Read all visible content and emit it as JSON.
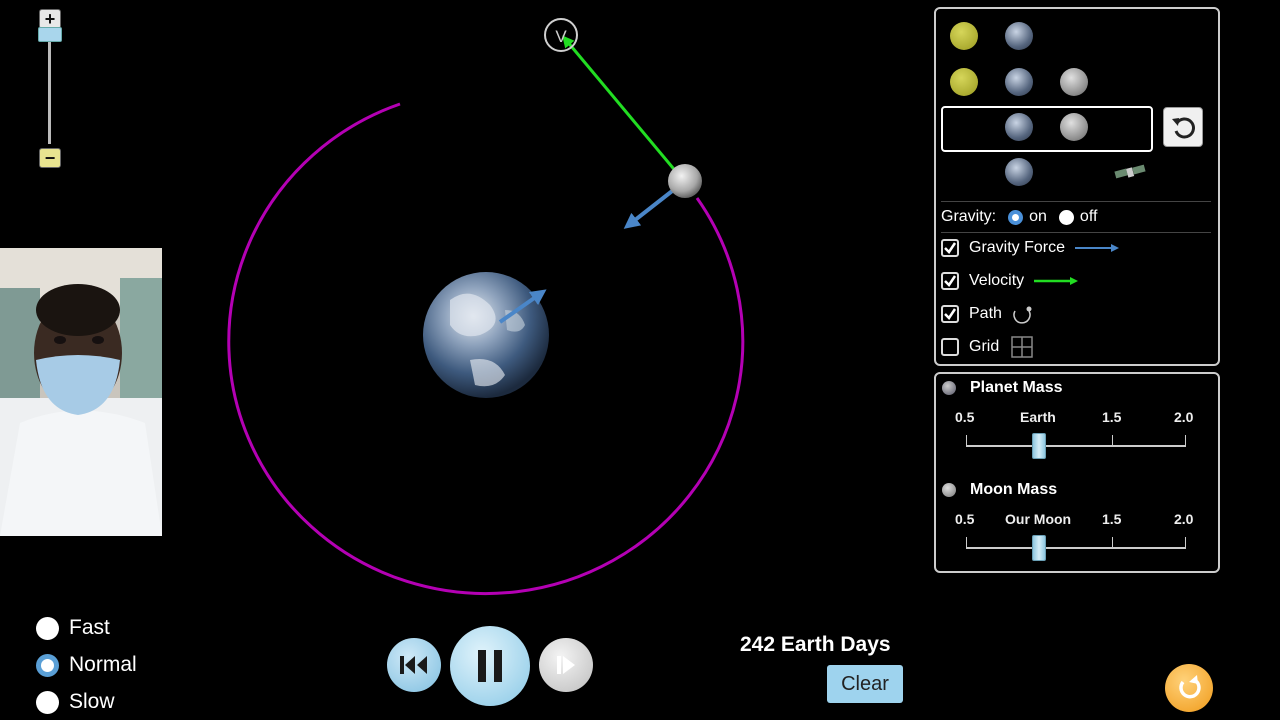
{
  "zoom": {
    "in_label": "+",
    "out_label": "−",
    "level": 0.94
  },
  "controls": {
    "gravity_label": "Gravity:",
    "gravity_on": "on",
    "gravity_off": "off",
    "gravity_selected": "on",
    "gravity_force_label": "Gravity Force",
    "velocity_label": "Velocity",
    "path_label": "Path",
    "grid_label": "Grid",
    "gravity_force_checked": true,
    "velocity_checked": true,
    "path_checked": true,
    "grid_checked": false
  },
  "planet_mass": {
    "title": "Planet Mass",
    "ticks": [
      "0.5",
      "Earth",
      "1.5",
      "2.0"
    ],
    "value": 1.0
  },
  "moon_mass": {
    "title": "Moon Mass",
    "ticks": [
      "0.5",
      "Our Moon",
      "1.5",
      "2.0"
    ],
    "value": 1.0
  },
  "speed": {
    "options": [
      "Fast",
      "Normal",
      "Slow"
    ],
    "selected": "Normal"
  },
  "time": {
    "days_label": "242 Earth Days"
  },
  "buttons": {
    "clear_label": "Clear"
  },
  "vectors": {
    "velocity_marker": "V"
  },
  "colors": {
    "orbit_path": "#b400b4",
    "velocity_arrow": "#22dd22",
    "gravity_arrow": "#4a86c8",
    "button_blue": "#9ed3ee",
    "reset_orange": "#f09a1a"
  }
}
